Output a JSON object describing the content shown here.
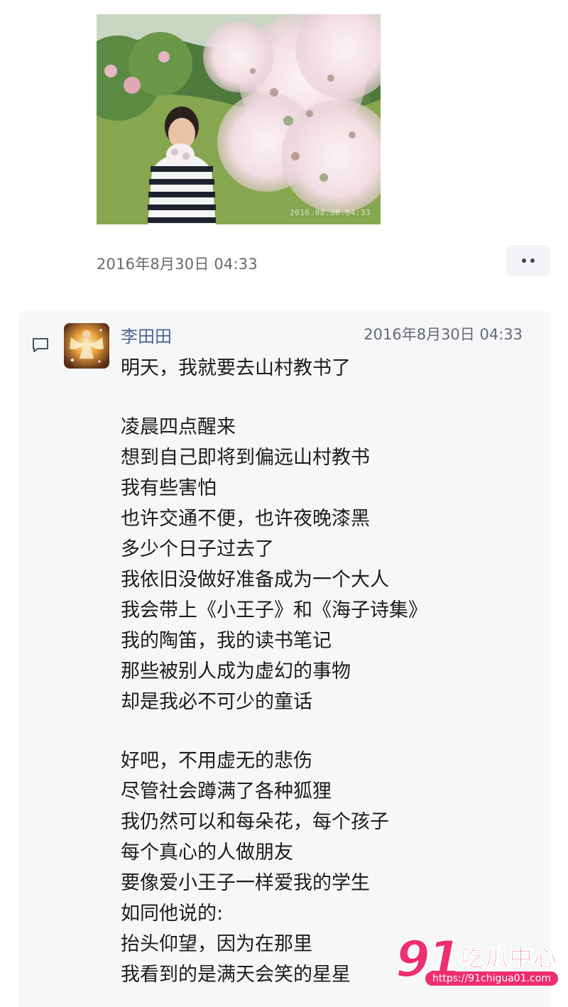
{
  "post": {
    "photo_stamp": "2016.08.30.04:33",
    "time": "2016年8月30日 04:33",
    "more_icon": "ellipsis-icon"
  },
  "comment": {
    "icon": "comment-icon",
    "author": "李田田",
    "time": "2016年8月30日 04:33",
    "lines": [
      "明天，我就要去山村教书了",
      "",
      "凌晨四点醒来",
      "想到自己即将到偏远山村教书",
      "我有些害怕",
      "也许交通不便，也许夜晚漆黑",
      "多少个日子过去了",
      "我依旧没做好准备成为一个大人",
      "我会带上《小王子》和《海子诗集》",
      "我的陶笛，我的读书笔记",
      "那些被别人成为虚幻的事物",
      "却是我必不可少的童话",
      "",
      "好吧，不用虚无的悲伤",
      "尽管社会蹲满了各种狐狸",
      "我仍然可以和每朵花，每个孩子",
      "每个真心的人做朋友",
      "要像爱小王子一样爱我的学生",
      "如同他说的:",
      "抬头仰望，因为在那里",
      "我看到的是满天会笑的星星"
    ]
  },
  "watermark": {
    "number": "91",
    "brand": "吃瓜中心",
    "url": "https://91chigua01.com"
  },
  "colors": {
    "author": "#4e6590",
    "card_bg": "#f6f7f9",
    "watermark": "#ee2e6e"
  }
}
